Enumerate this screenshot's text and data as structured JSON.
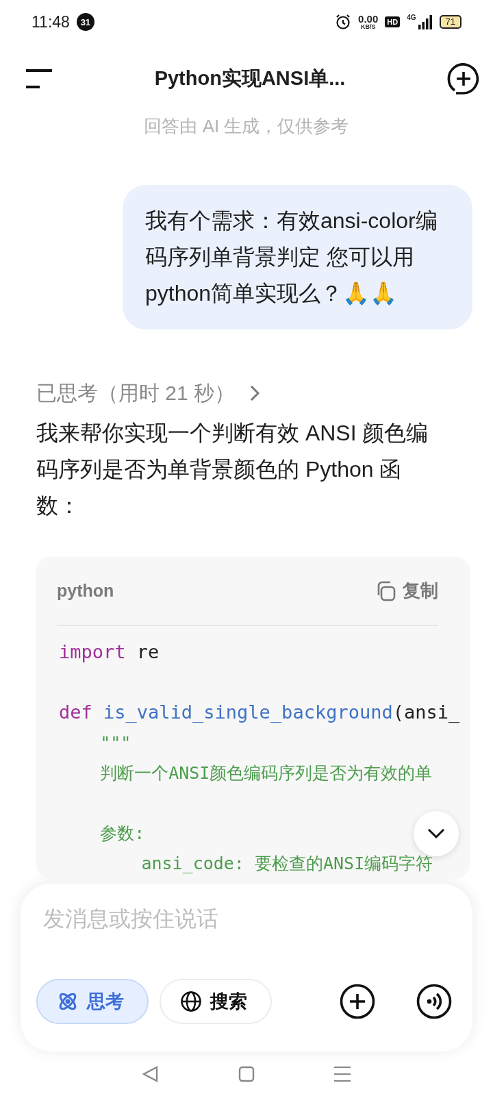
{
  "status_bar": {
    "time": "11:48",
    "notification_badge": "31",
    "net_speed": "0.00",
    "net_unit": "KB/S",
    "hd_label": "HD",
    "network": "4G",
    "battery": "71"
  },
  "header": {
    "title": "Python实现ANSI单...",
    "subtitle": "回答由 AI 生成，仅供参考"
  },
  "user_message": "我有个需求：有效ansi-color编码序列单背景判定 您可以用python简单实现么？🙏🙏",
  "thinking": {
    "label": "已思考（用时 21 秒）"
  },
  "answer_intro": "我来帮你实现一个判断有效 ANSI 颜色编码序列是否为单背景颜色的 Python 函数：",
  "code_block": {
    "language": "python",
    "copy_label": "复制",
    "lines": [
      {
        "kind": "code",
        "tokens": [
          {
            "kind": "keyword",
            "text": "import"
          },
          {
            "kind": "plain",
            "text": " re"
          }
        ]
      },
      {
        "kind": "blank"
      },
      {
        "kind": "code",
        "tokens": [
          {
            "kind": "keyword",
            "text": "def"
          },
          {
            "kind": "function",
            "text": " is_valid_single_background"
          },
          {
            "kind": "plain",
            "text": "(ansi_"
          }
        ]
      },
      {
        "kind": "code",
        "tokens": [
          {
            "kind": "comment",
            "text": "    \"\"\""
          }
        ]
      },
      {
        "kind": "code",
        "tokens": [
          {
            "kind": "comment",
            "text": "    判断一个ANSI颜色编码序列是否为有效的单"
          }
        ]
      },
      {
        "kind": "blank"
      },
      {
        "kind": "code",
        "tokens": [
          {
            "kind": "comment",
            "text": "    参数:"
          }
        ]
      },
      {
        "kind": "code",
        "tokens": [
          {
            "kind": "comment",
            "text": "        ansi_code: 要检查的ANSI编码字符"
          }
        ]
      }
    ]
  },
  "composer": {
    "placeholder": "发消息或按住说话",
    "modes": [
      {
        "kind": "think",
        "label": "思考",
        "selected": true
      },
      {
        "kind": "search",
        "label": "搜索",
        "selected": false
      }
    ]
  }
}
